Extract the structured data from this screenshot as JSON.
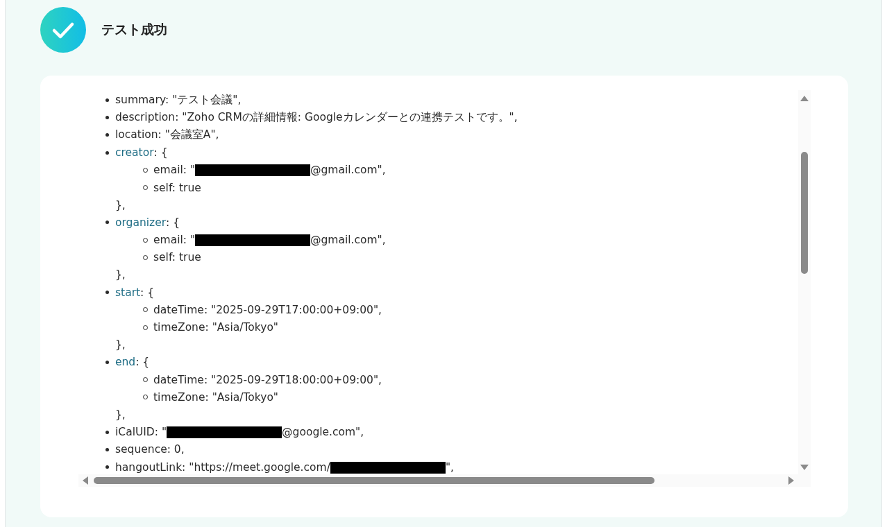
{
  "header": {
    "title": "テスト成功"
  },
  "entries": [
    {
      "kind": "field",
      "text": "summary: \"テスト会議\","
    },
    {
      "kind": "field",
      "text": "description: \"Zoho CRMの詳細情報: Googleカレンダーとの連携テストです。\","
    },
    {
      "kind": "field",
      "text": "location: \"会議室A\","
    },
    {
      "kind": "object",
      "key": "creator",
      "open": ": {",
      "close": "},",
      "children": [
        {
          "kind": "field",
          "text": "email: \"",
          "redacted": true,
          "after": "@gmail.com\","
        },
        {
          "kind": "field",
          "text": "self: true"
        }
      ]
    },
    {
      "kind": "object",
      "key": "organizer",
      "open": ": {",
      "close": "},",
      "children": [
        {
          "kind": "field",
          "text": "email: \"",
          "redacted": true,
          "after": "@gmail.com\","
        },
        {
          "kind": "field",
          "text": "self: true"
        }
      ]
    },
    {
      "kind": "object",
      "key": "start",
      "open": ": {",
      "close": "},",
      "children": [
        {
          "kind": "field",
          "text": "dateTime: \"2025-09-29T17:00:00+09:00\","
        },
        {
          "kind": "field",
          "text": "timeZone: \"Asia/Tokyo\""
        }
      ]
    },
    {
      "kind": "object",
      "key": "end",
      "open": ": {",
      "close": "},",
      "children": [
        {
          "kind": "field",
          "text": "dateTime: \"2025-09-29T18:00:00+09:00\","
        },
        {
          "kind": "field",
          "text": "timeZone: \"Asia/Tokyo\""
        }
      ]
    },
    {
      "kind": "field",
      "text": "iCalUID: \"",
      "redacted": true,
      "after": "@google.com\","
    },
    {
      "kind": "field",
      "text": "sequence: 0,"
    },
    {
      "kind": "field",
      "text": "hangoutLink: \"https://meet.google.com/",
      "redacted": true,
      "after": "\","
    }
  ]
}
